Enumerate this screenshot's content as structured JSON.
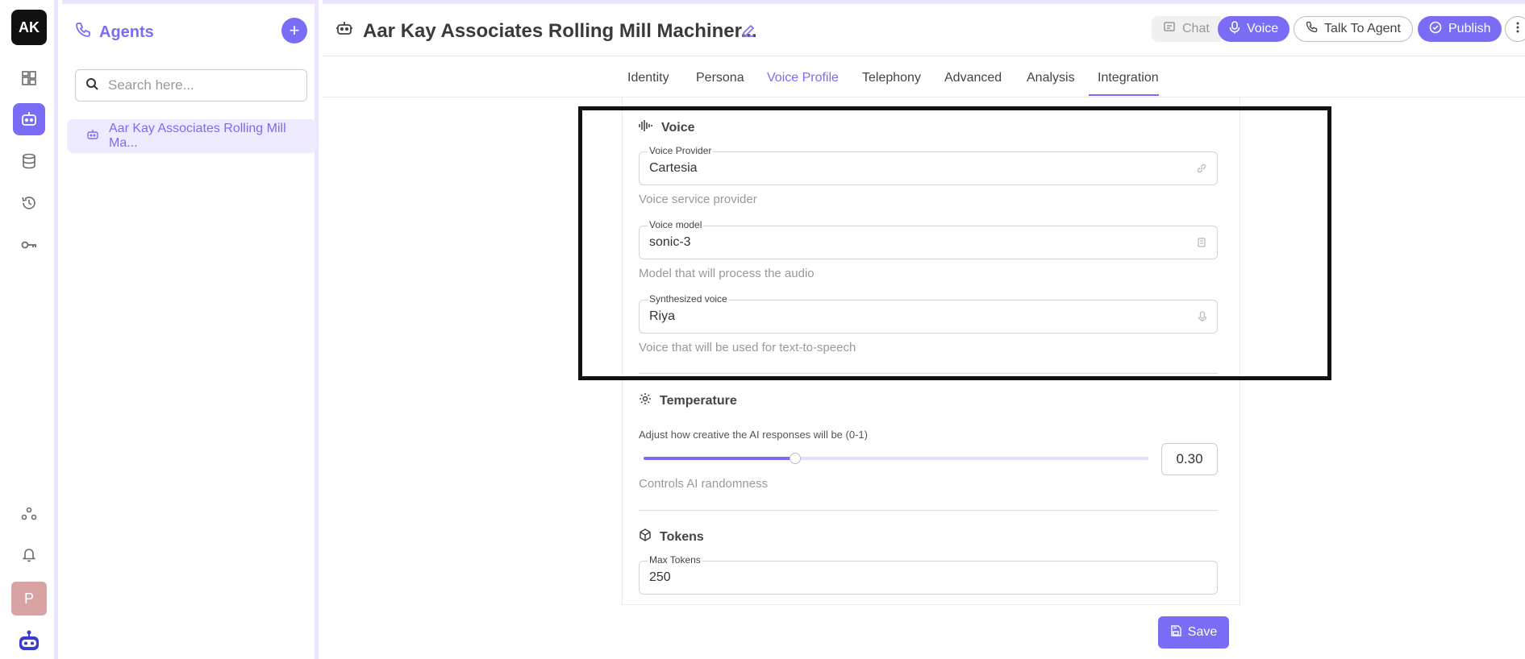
{
  "rail": {
    "logo": "AK",
    "avatar": "P"
  },
  "agents_panel": {
    "title": "Agents",
    "search_placeholder": "Search here...",
    "items": [
      {
        "label": "Aar Kay Associates Rolling Mill Ma..."
      }
    ]
  },
  "header": {
    "title": "Aar Kay Associates Rolling Mill Machiner...",
    "chat_label": "Chat",
    "voice_label": "Voice",
    "talk_label": "Talk To Agent",
    "publish_label": "Publish"
  },
  "tabs": [
    "Identity",
    "Persona",
    "Voice Profile",
    "Telephony",
    "Advanced",
    "Analysis",
    "Integration"
  ],
  "active_tab": "Voice Profile",
  "voice_section": {
    "title": "Voice",
    "provider": {
      "label": "Voice Provider",
      "value": "Cartesia",
      "help": "Voice service provider"
    },
    "model": {
      "label": "Voice model",
      "value": "sonic-3",
      "help": "Model that will process the audio"
    },
    "synth": {
      "label": "Synthesized voice",
      "value": "Riya",
      "help": "Voice that will be used for text-to-speech"
    }
  },
  "temperature_section": {
    "title": "Temperature",
    "caption": "Adjust how creative the AI responses will be (0-1)",
    "value": "0.30",
    "help": "Controls AI randomness"
  },
  "tokens_section": {
    "title": "Tokens",
    "max_tokens": {
      "label": "Max Tokens",
      "value": "250"
    }
  },
  "save_label": "Save",
  "colors": {
    "accent": "#7b6cf6",
    "border": "#ece4fb"
  }
}
